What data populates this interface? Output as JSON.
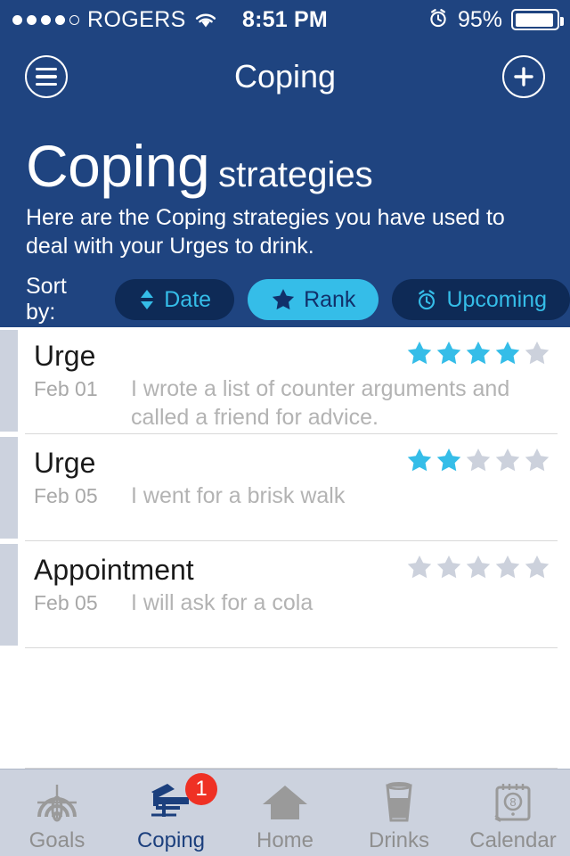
{
  "status_bar": {
    "signal_dots_filled": 4,
    "signal_dots_total": 5,
    "carrier": "ROGERS",
    "wifi_icon": "wifi-icon",
    "time": "8:51 PM",
    "alarm_icon": "alarm-clock-icon",
    "battery_percent": "95%",
    "battery_level": 95
  },
  "navbar": {
    "menu_icon": "hamburger-menu-icon",
    "title": "Coping",
    "add_icon": "plus-icon"
  },
  "header": {
    "headline_primary": "Coping",
    "headline_secondary": "strategies",
    "subtitle": "Here are the Coping strategies you have used to deal with your Urges to drink.",
    "sort_label": "Sort by:",
    "sort_options": [
      {
        "label": "Date",
        "icon": "sort-arrows-icon",
        "active": false
      },
      {
        "label": "Rank",
        "icon": "star-icon",
        "active": true
      },
      {
        "label": "Upcoming",
        "icon": "alarm-clock-icon",
        "active": false
      }
    ]
  },
  "list": {
    "max_stars": 5,
    "rows": [
      {
        "title": "Urge",
        "date": "Feb 01",
        "text": "I wrote a list of counter arguments and called a friend for advice.",
        "rating": 4
      },
      {
        "title": "Urge",
        "date": "Feb 05",
        "text": "I went for a brisk walk",
        "rating": 2
      },
      {
        "title": "Appointment",
        "date": "Feb 05",
        "text": "I will ask for a cola",
        "rating": 0
      }
    ]
  },
  "tabbar": {
    "tabs": [
      {
        "label": "Goals",
        "icon": "target-icon",
        "active": false,
        "badge": null
      },
      {
        "label": "Coping",
        "icon": "deck-chair-icon",
        "active": true,
        "badge": "1"
      },
      {
        "label": "Home",
        "icon": "house-icon",
        "active": false,
        "badge": null
      },
      {
        "label": "Drinks",
        "icon": "glass-icon",
        "active": false,
        "badge": null
      },
      {
        "label": "Calendar",
        "icon": "calendar-icon",
        "active": false,
        "badge": null
      }
    ]
  },
  "colors": {
    "header_blue": "#1f4480",
    "pill_dark": "#0e2a56",
    "accent_cyan": "#35bde8",
    "star_empty": "#ccd1dc",
    "badge_red": "#ef3124",
    "tabbar_bg": "#ccd2de",
    "tab_active": "#1b3f7d"
  }
}
